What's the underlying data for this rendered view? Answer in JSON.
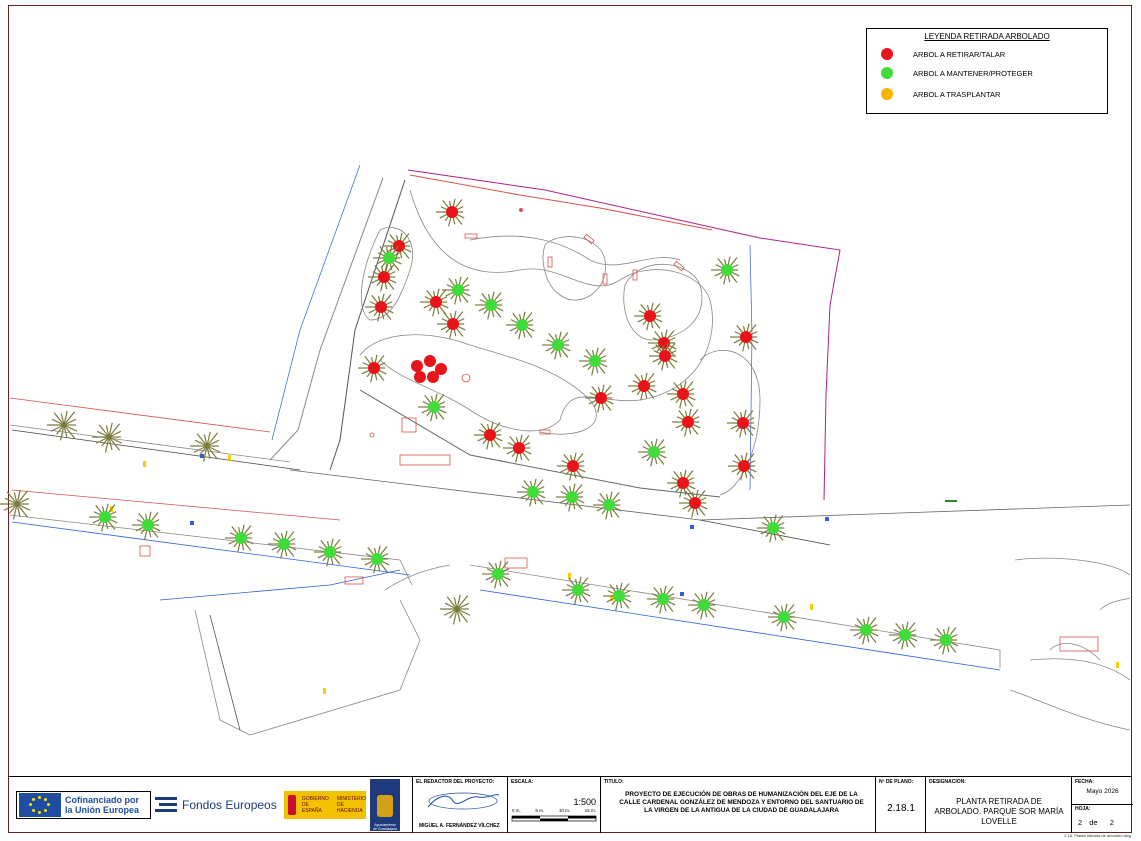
{
  "legend": {
    "title": "LEYENDA RETIRADA ARBOLADO",
    "items": [
      {
        "label": "ARBOL A RETIRAR/TALAR",
        "color": "#e8141a"
      },
      {
        "label": "ARBOL A MANTENER/PROTEGER",
        "color": "#3fdc3a"
      },
      {
        "label": "ARBOL A TRASPLANTAR",
        "color": "#f4b400"
      }
    ]
  },
  "colors": {
    "frame": "#6b1f1f",
    "remove": "#e8141a",
    "keep": "#3fdc3a",
    "canopy": "#7a7a3a",
    "path": "#888888",
    "kerb_red": "#d9534f",
    "road_blue": "#2e5fd8",
    "plot_magenta": "#b0208a"
  },
  "title_block": {
    "logos": {
      "eu_text_1": "Cofinanciado por",
      "eu_text_2": "la Unión Europea",
      "funds": "Fondos Europeos",
      "gov_1": "GOBIERNO",
      "gov_2": "DE ESPAÑA",
      "ministry_1": "MINISTERIO",
      "ministry_2": "DE HACIENDA",
      "city_1": "Ayuntamiento",
      "city_2": "de Guadalajara"
    },
    "redactor_label": "EL REDACTOR DEL PROYECTO:",
    "redactor_name": "MIGUEL A. FERNÁNDEZ VÍLCHEZ",
    "escala_label": "ESCALA:",
    "scale": "1:500",
    "scale_ticks": [
      "0 m.",
      "5 m.",
      "10 m.",
      "15 m."
    ],
    "titulo_label": "TITULO:",
    "titulo": "PROYECTO DE EJECUCIÓN DE OBRAS DE HUMANIZACIÓN DEL EJE DE LA CALLE CARDENAL GONZÁLEZ DE MENDOZA Y ENTORNO DEL SANTUARIO DE LA VIRGEN DE LA ANTIGUA DE LA CIUDAD DE GUADALAJARA",
    "plano_label": "Nº DE PLANO:",
    "plano": "2.18.1",
    "designacion_label": "DESIGNACION:",
    "designacion": "PLANTA RETIRADA DE ARBOLADO. PARQUE SOR MARÍA LOVELLE",
    "fecha_label": "FECHA:",
    "fecha": "Mayo 2026",
    "hoja_label": "HOJA:",
    "hoja_num": "2",
    "hoja_de": "de",
    "hoja_total": "2",
    "file_ref": "2.18. Planta retirada de arbolado.dwg"
  },
  "trees": {
    "remove": [
      [
        452,
        212
      ],
      [
        399,
        246
      ],
      [
        384,
        277
      ],
      [
        381,
        307
      ],
      [
        436,
        302
      ],
      [
        453,
        324
      ],
      [
        374,
        368
      ],
      [
        490,
        435
      ],
      [
        519,
        448
      ],
      [
        573,
        466
      ],
      [
        601,
        398
      ],
      [
        644,
        386
      ],
      [
        650,
        316
      ],
      [
        664,
        343
      ],
      [
        665,
        356
      ],
      [
        683,
        394
      ],
      [
        688,
        422
      ],
      [
        746,
        337
      ],
      [
        743,
        423
      ],
      [
        744,
        466
      ],
      [
        683,
        483
      ],
      [
        695,
        503
      ]
    ],
    "keep": [
      [
        389,
        258
      ],
      [
        458,
        290
      ],
      [
        491,
        305
      ],
      [
        522,
        325
      ],
      [
        558,
        345
      ],
      [
        595,
        361
      ],
      [
        434,
        407
      ],
      [
        654,
        452
      ],
      [
        533,
        492
      ],
      [
        572,
        497
      ],
      [
        609,
        505
      ],
      [
        727,
        270
      ],
      [
        773,
        528
      ],
      [
        105,
        517
      ],
      [
        148,
        525
      ],
      [
        241,
        538
      ],
      [
        284,
        544
      ],
      [
        330,
        552
      ],
      [
        377,
        559
      ],
      [
        498,
        574
      ],
      [
        578,
        590
      ],
      [
        619,
        596
      ],
      [
        663,
        599
      ],
      [
        704,
        605
      ],
      [
        784,
        617
      ],
      [
        866,
        630
      ],
      [
        905,
        635
      ],
      [
        946,
        640
      ]
    ],
    "remove_cluster": [
      [
        417,
        366
      ],
      [
        430,
        361
      ],
      [
        441,
        369
      ],
      [
        433,
        377
      ],
      [
        420,
        377
      ]
    ],
    "olive_only": [
      [
        64,
        425
      ],
      [
        109,
        437
      ],
      [
        207,
        446
      ],
      [
        17,
        504
      ],
      [
        457,
        609
      ]
    ]
  }
}
